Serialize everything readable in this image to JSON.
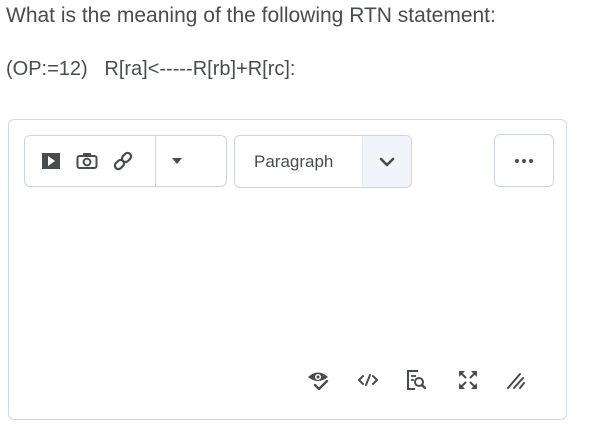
{
  "question": {
    "text": "What is the meaning of the following RTN statement:",
    "statement": "(OP:=12)   R[ra]<-----R[rb]+R[rc]:"
  },
  "editor": {
    "toolbar": {
      "icons": [
        "play-icon",
        "camera-icon",
        "link-icon",
        "dropdown-arrow-icon"
      ]
    },
    "format_select": {
      "value": "Paragraph"
    },
    "more_icon": "more-options-icon",
    "bottom_icons": [
      "accessibility-checker-icon",
      "source-code-icon",
      "preview-icon",
      "fullscreen-icon",
      "resize-handle-icon"
    ]
  }
}
